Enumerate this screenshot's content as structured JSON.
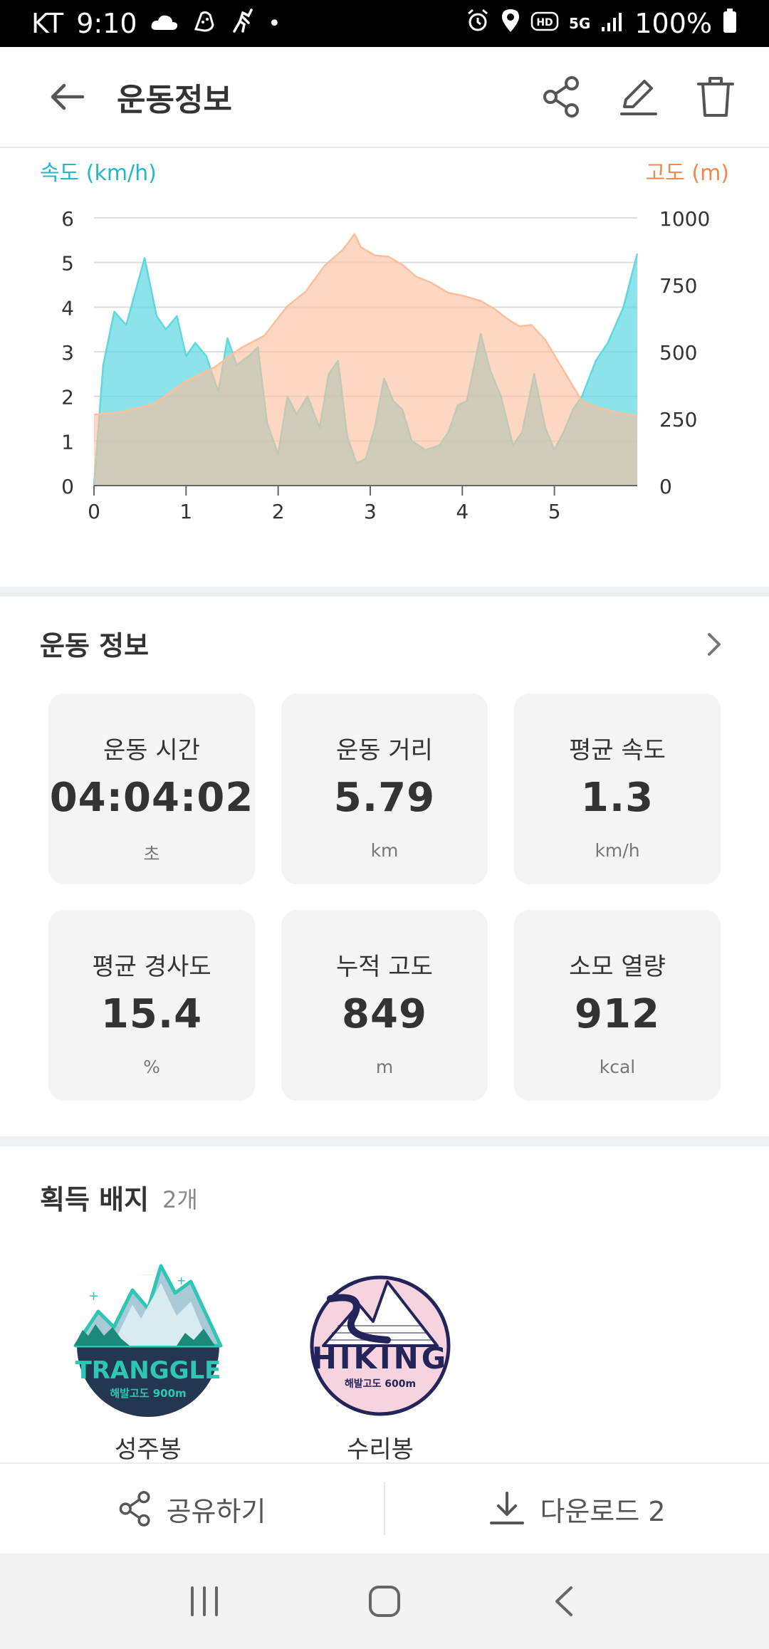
{
  "status_bar": {
    "carrier": "KT",
    "time": "9:10",
    "dot": "•",
    "network": "5G",
    "battery": "100%"
  },
  "header": {
    "title": "운동정보"
  },
  "chart_data": {
    "type": "area",
    "left_axis_label": "속도 (km/h)",
    "right_axis_label": "고도 (m)",
    "x_ticks": [
      "0",
      "1",
      "2",
      "3",
      "4",
      "5"
    ],
    "y_left_ticks": [
      "0",
      "1",
      "2",
      "3",
      "4",
      "5",
      "6"
    ],
    "y_right_ticks": [
      "0",
      "250",
      "500",
      "750",
      "1000"
    ],
    "xlim": [
      0,
      5.9
    ],
    "ylim_left": [
      0,
      6
    ],
    "ylim_right": [
      0,
      1000
    ],
    "grid": true,
    "series": [
      {
        "name": "속도 (km/h)",
        "axis": "left",
        "color": "#5fd8e0",
        "x": [
          0,
          0.1,
          0.22,
          0.35,
          0.55,
          0.68,
          0.78,
          0.9,
          1.0,
          1.1,
          1.22,
          1.35,
          1.45,
          1.55,
          1.68,
          1.78,
          1.88,
          2.0,
          2.1,
          2.2,
          2.32,
          2.45,
          2.55,
          2.65,
          2.75,
          2.85,
          2.95,
          3.05,
          3.15,
          3.25,
          3.35,
          3.45,
          3.6,
          3.75,
          3.85,
          3.95,
          4.05,
          4.2,
          4.3,
          4.42,
          4.55,
          4.65,
          4.78,
          4.9,
          5.0,
          5.1,
          5.2,
          5.3,
          5.45,
          5.58,
          5.75,
          5.9
        ],
        "values": [
          0,
          2.7,
          3.9,
          3.6,
          5.1,
          3.8,
          3.5,
          3.8,
          2.9,
          3.2,
          2.9,
          2.1,
          3.3,
          2.7,
          2.9,
          3.1,
          1.4,
          0.7,
          2.0,
          1.6,
          2.0,
          1.3,
          2.5,
          2.8,
          1.1,
          0.5,
          0.6,
          1.3,
          2.4,
          1.9,
          1.7,
          1.0,
          0.8,
          0.9,
          1.2,
          1.8,
          1.9,
          3.4,
          2.6,
          2.0,
          0.9,
          1.2,
          2.5,
          1.3,
          0.8,
          1.2,
          1.7,
          2.0,
          2.8,
          3.2,
          4.0,
          5.2
        ]
      },
      {
        "name": "고도 (m)",
        "axis": "right",
        "color": "#fcbf9c",
        "x": [
          0,
          0.3,
          0.65,
          1.0,
          1.3,
          1.6,
          1.85,
          2.1,
          2.3,
          2.5,
          2.7,
          2.83,
          2.9,
          3.05,
          3.2,
          3.35,
          3.5,
          3.65,
          3.85,
          4.0,
          4.2,
          4.35,
          4.5,
          4.62,
          4.75,
          4.9,
          5.1,
          5.3,
          5.45,
          5.65,
          5.9
        ],
        "values": [
          265,
          275,
          305,
          390,
          440,
          515,
          560,
          670,
          725,
          820,
          880,
          940,
          890,
          860,
          855,
          825,
          780,
          760,
          720,
          710,
          690,
          660,
          620,
          595,
          600,
          545,
          430,
          315,
          295,
          275,
          260
        ]
      }
    ]
  },
  "exercise_info": {
    "title": "운동 정보",
    "stats": [
      {
        "label": "운동 시간",
        "value": "04:04:02",
        "unit": "초"
      },
      {
        "label": "운동 거리",
        "value": "5.79",
        "unit": "km"
      },
      {
        "label": "평균 속도",
        "value": "1.3",
        "unit": "km/h"
      },
      {
        "label": "평균 경사도",
        "value": "15.4",
        "unit": "%"
      },
      {
        "label": "누적 고도",
        "value": "849",
        "unit": "m"
      },
      {
        "label": "소모 열량",
        "value": "912",
        "unit": "kcal"
      }
    ]
  },
  "badges": {
    "title": "획득 배지",
    "count": "2개",
    "items": [
      {
        "name": "성주봉",
        "logo_text": "TRANGGLE",
        "logo_sub": "해발고도 900m"
      },
      {
        "name": "수리봉",
        "logo_text": "HIKING",
        "logo_sub": "해발고도 600m"
      }
    ]
  },
  "actions": {
    "share_label": "공유하기",
    "download_label": "다운로드 2"
  },
  "colors": {
    "speed": "#5fd8e0",
    "altitude": "#fcbf9c",
    "speed_text": "#22b8c4",
    "altitude_text": "#f08a4b"
  }
}
